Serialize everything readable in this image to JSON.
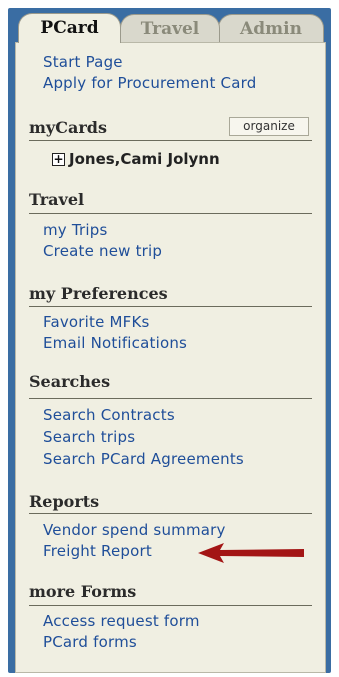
{
  "tabs": [
    {
      "label": "PCard",
      "active": true
    },
    {
      "label": "Travel",
      "active": false
    },
    {
      "label": "Admin",
      "active": false
    }
  ],
  "top_links": [
    "Start Page",
    "Apply for Procurement Card"
  ],
  "mycards": {
    "heading": "myCards",
    "organize_label": "organize",
    "card_name": "Jones,Cami Jolynn",
    "expand_glyph": "+"
  },
  "sections": {
    "travel": {
      "heading": "Travel",
      "links": [
        "my Trips",
        "Create new trip"
      ]
    },
    "preferences": {
      "heading": "my Preferences",
      "links": [
        "Favorite MFKs",
        "Email Notifications"
      ]
    },
    "searches": {
      "heading": "Searches",
      "links": [
        "Search Contracts",
        "Search trips",
        "Search PCard Agreements"
      ]
    },
    "reports": {
      "heading": "Reports",
      "links": [
        "Vendor spend summary",
        "Freight Report"
      ]
    },
    "forms": {
      "heading": "more Forms",
      "links": [
        "Access request form",
        "PCard forms"
      ]
    }
  },
  "colors": {
    "frame": "#3a6da3",
    "panel": "#f0efe2",
    "link": "#1f4e99",
    "arrow": "#a31515"
  }
}
